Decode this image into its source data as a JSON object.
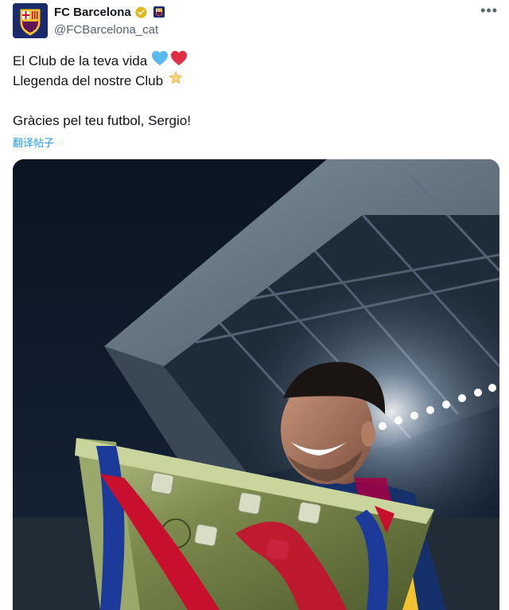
{
  "account": {
    "display_name": "FC Barcelona",
    "handle": "@FCBarcelona_cat",
    "verified_icon": "verified-gold-badge-icon",
    "affiliation_icon": "fcb-crest-icon"
  },
  "tweet": {
    "lines": [
      "El Club de la teva vida",
      "Llegenda del nostre Club",
      "Gràcies pel teu futbol, Sergio!"
    ],
    "emojis": [
      "blue-heart-icon",
      "red-heart-icon",
      "glowing-star-icon"
    ]
  },
  "translate_label": "翻译帖子",
  "more_menu_icon": "more-options-icon",
  "media": {
    "type": "photo",
    "subject": "player holding trophy in stadium at night"
  },
  "colors": {
    "handle_gray": "#536471",
    "link_blue": "#1d9bf0",
    "verified_gold": "#e2b719",
    "barca_blue": "#1b2a6b",
    "barca_red": "#a50044"
  }
}
